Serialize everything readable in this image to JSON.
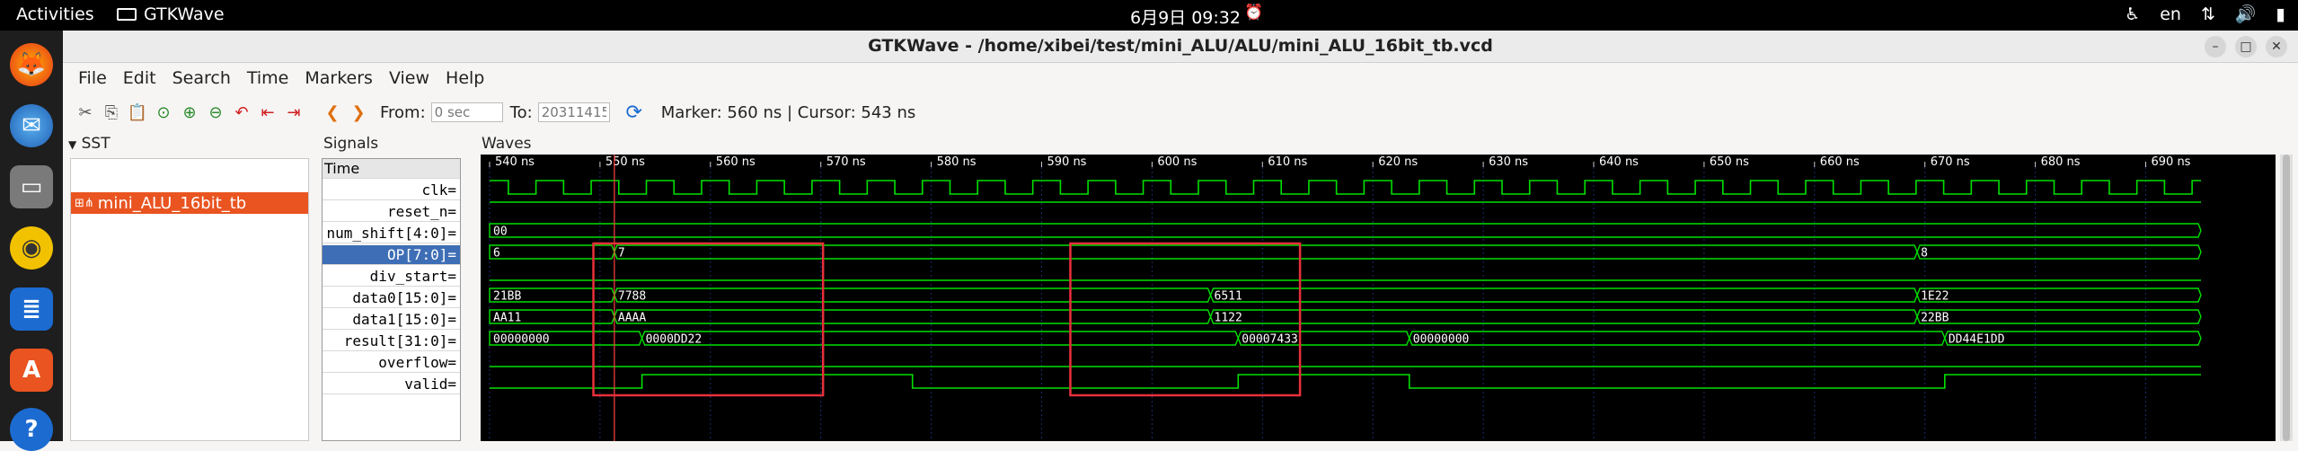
{
  "topbar": {
    "activities": "Activities",
    "app_name": "GTKWave",
    "clock": "6月9日  09:32",
    "language": "en"
  },
  "window": {
    "title": "GTKWave - /home/xibei/test/mini_ALU/ALU/mini_ALU_16bit_tb.vcd"
  },
  "menus": [
    "File",
    "Edit",
    "Search",
    "Time",
    "Markers",
    "View",
    "Help"
  ],
  "toolbar": {
    "from_label": "From:",
    "from_value": "0 sec",
    "to_label": "To:",
    "to_value": "20311415",
    "marker_text": "Marker: 560 ns  |  Cursor: 543 ns"
  },
  "sst": {
    "title": "SST",
    "tree_item": "mini_ALU_16bit_tb"
  },
  "signals": {
    "title": "Signals",
    "time_label": "Time",
    "rows": [
      "clk=",
      "reset_n=",
      "num_shift[4:0]=",
      "OP[7:0]=",
      "div_start=",
      "data0[15:0]=",
      "data1[15:0]=",
      "result[31:0]=",
      "overflow=",
      "valid="
    ]
  },
  "waves": {
    "title": "Waves",
    "time_start_ns": 540,
    "time_end_ns": 695,
    "tick_labels": [
      "540 ns",
      "550 ns",
      "560 ns",
      "570 ns",
      "580 ns",
      "590 ns",
      "600 ns",
      "610 ns",
      "620 ns",
      "630 ns",
      "640 ns",
      "650 ns",
      "660 ns",
      "670 ns",
      "680 ns",
      "690 ns"
    ],
    "tick_values": [
      540,
      550,
      560,
      570,
      580,
      590,
      600,
      610,
      620,
      630,
      640,
      650,
      660,
      670,
      680,
      690
    ],
    "cursor_ns": 551.3,
    "clk_period_ns": 5,
    "clk_first_rise_ns": 544.2,
    "num_shift": [
      {
        "t": 540,
        "v": "00"
      }
    ],
    "op": [
      {
        "t": 540,
        "v": "6"
      },
      {
        "t": 551.3,
        "v": "7"
      },
      {
        "t": 669.3,
        "v": "8"
      }
    ],
    "data0": [
      {
        "t": 540,
        "v": "21BB"
      },
      {
        "t": 551.3,
        "v": "7788"
      },
      {
        "t": 605.3,
        "v": "6511"
      },
      {
        "t": 669.3,
        "v": "1E22"
      }
    ],
    "data1": [
      {
        "t": 540,
        "v": "AA11"
      },
      {
        "t": 551.3,
        "v": "AAAA"
      },
      {
        "t": 605.3,
        "v": "1122"
      },
      {
        "t": 669.3,
        "v": "22BB"
      }
    ],
    "result": [
      {
        "t": 540,
        "v": "00000000"
      },
      {
        "t": 553.8,
        "v": "0000DD22"
      },
      {
        "t": 607.8,
        "v": "00007433"
      },
      {
        "t": 623.3,
        "v": "00000000"
      },
      {
        "t": 671.8,
        "v": "DD44E1DD"
      }
    ],
    "valid_high": [
      [
        553.8,
        578.3
      ],
      [
        607.8,
        623.3
      ],
      [
        671.8,
        695
      ]
    ],
    "highlight_boxes": [
      [
        549.4,
        570.2
      ],
      [
        592.6,
        613.4
      ]
    ]
  }
}
